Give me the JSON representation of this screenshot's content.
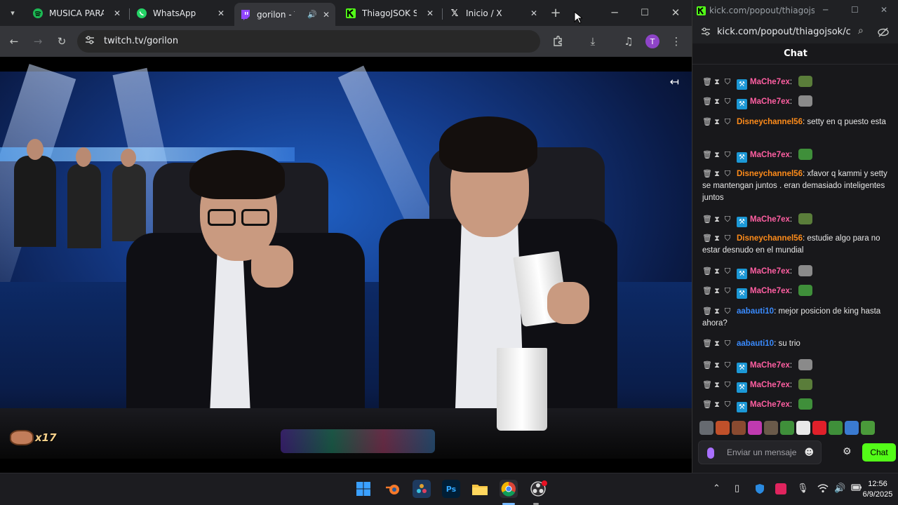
{
  "browser": {
    "tabs": [
      {
        "label": "MUSICA PARA S",
        "icon": "spotify-icon",
        "color": "#1db954"
      },
      {
        "label": "WhatsApp",
        "icon": "whatsapp-icon",
        "color": "#25d366"
      },
      {
        "label": "gorilon - Tw",
        "icon": "twitch-icon",
        "color": "#9146ff",
        "active": true,
        "audio": true
      },
      {
        "label": "ThiagoJSOK Stre",
        "icon": "kick-icon",
        "color": "#53fc18"
      },
      {
        "label": "Inicio / X",
        "icon": "x-icon",
        "color": "#ffffff"
      }
    ],
    "url": "twitch.tv/gorilon",
    "profile_initial": "T"
  },
  "video": {
    "badge_count": "x17"
  },
  "kick": {
    "window_title": "kick.com/popout/thiagojso...",
    "url": "kick.com/popout/thiagojsok/c...",
    "chat_title": "Chat",
    "messages": [
      {
        "user": "MaChe7ex",
        "color": "#ff5fa2",
        "mod": true,
        "text": "",
        "emote": "#5a7d3a"
      },
      {
        "user": "MaChe7ex",
        "color": "#ff5fa2",
        "mod": true,
        "text": "",
        "emote": "#8a8a8a"
      },
      {
        "user": "Disneychannel56",
        "color": "#ff8c1a",
        "mod": false,
        "text": "setty en q puesto esta"
      },
      {
        "user": "MaChe7ex",
        "color": "#ff5fa2",
        "mod": true,
        "text": "",
        "emote": "#3f8f3a"
      },
      {
        "user": "Disneychannel56",
        "color": "#ff8c1a",
        "mod": false,
        "text": "xfavor q kammi y setty se mantengan juntos . eran demasiado inteligentes juntos"
      },
      {
        "user": "MaChe7ex",
        "color": "#ff5fa2",
        "mod": true,
        "text": "",
        "emote": "#5a7d3a"
      },
      {
        "user": "Disneychannel56",
        "color": "#ff8c1a",
        "mod": false,
        "text": "estudie algo para no estar desnudo en el mundial"
      },
      {
        "user": "MaChe7ex",
        "color": "#ff5fa2",
        "mod": true,
        "text": "",
        "emote": "#8a8a8a"
      },
      {
        "user": "MaChe7ex",
        "color": "#ff5fa2",
        "mod": true,
        "text": "",
        "emote": "#3f8f3a"
      },
      {
        "user": "aabauti10",
        "color": "#3a8bff",
        "mod": false,
        "text": "mejor posicion de king hasta ahora?"
      },
      {
        "user": "aabauti10",
        "color": "#3a8bff",
        "mod": false,
        "text": "su trio"
      },
      {
        "user": "MaChe7ex",
        "color": "#ff5fa2",
        "mod": true,
        "text": "",
        "emote": "#8a8a8a"
      },
      {
        "user": "MaChe7ex",
        "color": "#ff5fa2",
        "mod": true,
        "text": "",
        "emote": "#5a7d3a"
      },
      {
        "user": "MaChe7ex",
        "color": "#ff5fa2",
        "mod": true,
        "text": "",
        "emote": "#3f8f3a"
      }
    ],
    "input_placeholder": "Enviar un mensaje",
    "chat_button": "Chat",
    "accent": "#53fc18"
  },
  "taskbar": {
    "time": "12:56",
    "date": "6/9/2025"
  }
}
